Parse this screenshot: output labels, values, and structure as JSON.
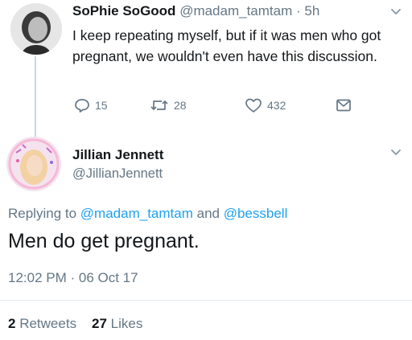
{
  "tweet1": {
    "display_name": "SoPhie SoGood",
    "handle": "@madam_tamtam",
    "separator": "·",
    "time": "5h",
    "text": "I keep repeating myself, but if it was men who got pregnant, we wouldn't even have this discussion.",
    "actions": {
      "reply_count": "15",
      "retweet_count": "28",
      "like_count": "432"
    }
  },
  "tweet2": {
    "display_name": "Jillian Jennett",
    "handle": "@JillianJennett",
    "replying": {
      "prefix": "Replying to",
      "mention1": "@madam_tamtam",
      "and": "and",
      "mention2": "@bessbell"
    },
    "text": "Men do get pregnant.",
    "timestamp": "12:02 PM · 06 Oct 17",
    "stats": {
      "retweets_count": "2",
      "retweets_label": "Retweets",
      "likes_count": "27",
      "likes_label": "Likes"
    }
  },
  "colors": {
    "link": "#1da1f2",
    "secondary_text": "#657786",
    "primary_text": "#14171a"
  },
  "icons": [
    "reply-icon",
    "retweet-icon",
    "like-icon",
    "dm-icon",
    "chevron-down-icon"
  ]
}
